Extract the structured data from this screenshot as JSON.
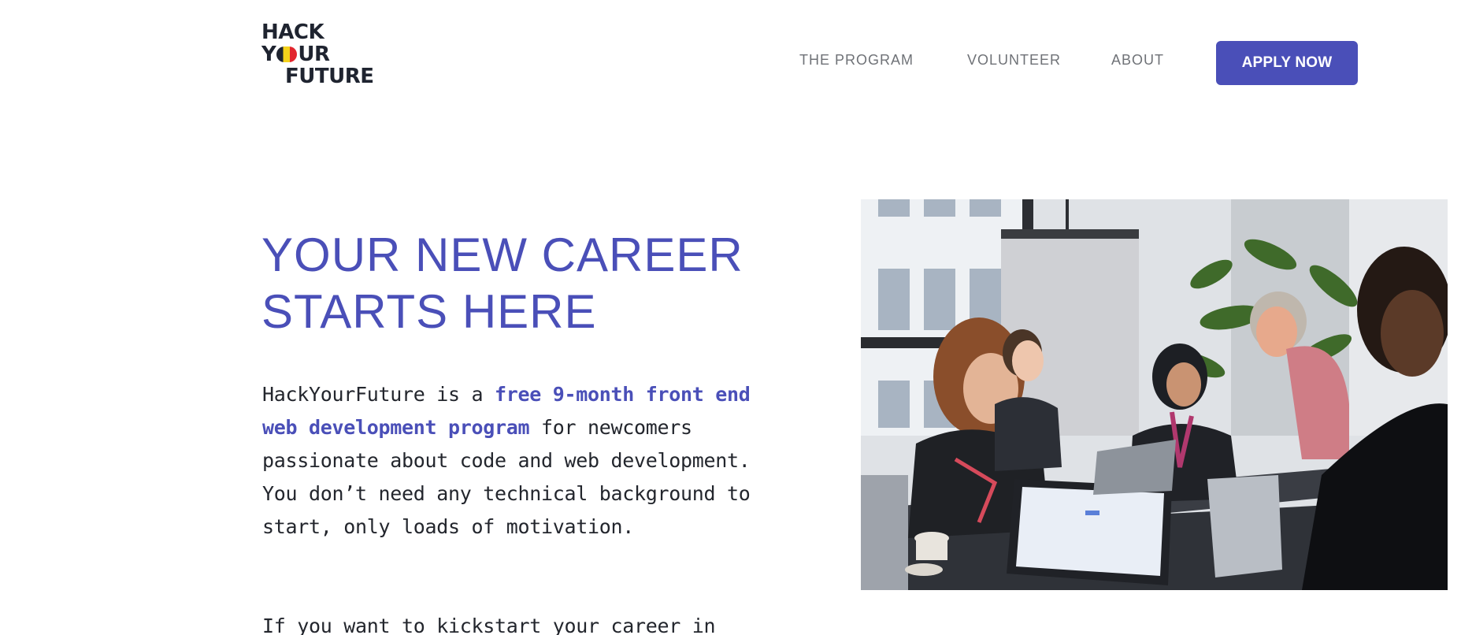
{
  "header": {
    "logo": {
      "line1": "HACK",
      "line2_start": "Y",
      "line2_end": "UR",
      "line3": "FUTURE"
    },
    "nav": [
      {
        "label": "THE PROGRAM"
      },
      {
        "label": "VOLUNTEER"
      },
      {
        "label": "ABOUT"
      }
    ],
    "cta_label": "APPLY NOW"
  },
  "hero": {
    "title_line1": "YOUR NEW CAREER",
    "title_line2": "STARTS HERE",
    "paragraph1": {
      "before": "HackYourFuture is a ",
      "highlight": "free 9-month front end web development program",
      "after": " for newcomers passionate about code and web development. You don’t need any technical background to start, only loads of motivation."
    },
    "paragraph2": "If you want to kickstart your career in"
  },
  "colors": {
    "brand": "#4a4fb8",
    "text": "#23262d",
    "nav": "#6f7277"
  }
}
